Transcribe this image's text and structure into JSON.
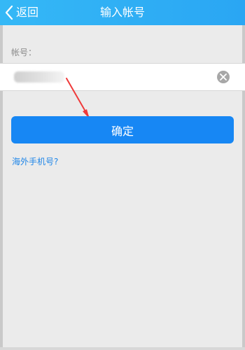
{
  "header": {
    "back_label": "返回",
    "title": "输入帐号"
  },
  "form": {
    "account_label": "帐号：",
    "account_value": "",
    "confirm_label": "确定"
  },
  "links": {
    "overseas_phone": "海外手机号?"
  },
  "colors": {
    "header_gradient_start": "#35b8f6",
    "header_gradient_end": "#2aa6f3",
    "confirm_button": "#1787f4",
    "link": "#1f86e8",
    "annotation_arrow": "#ef3a3a"
  },
  "icons": {
    "back": "chevron-left-icon",
    "clear": "clear-icon",
    "annotation": "arrow-annotation"
  }
}
